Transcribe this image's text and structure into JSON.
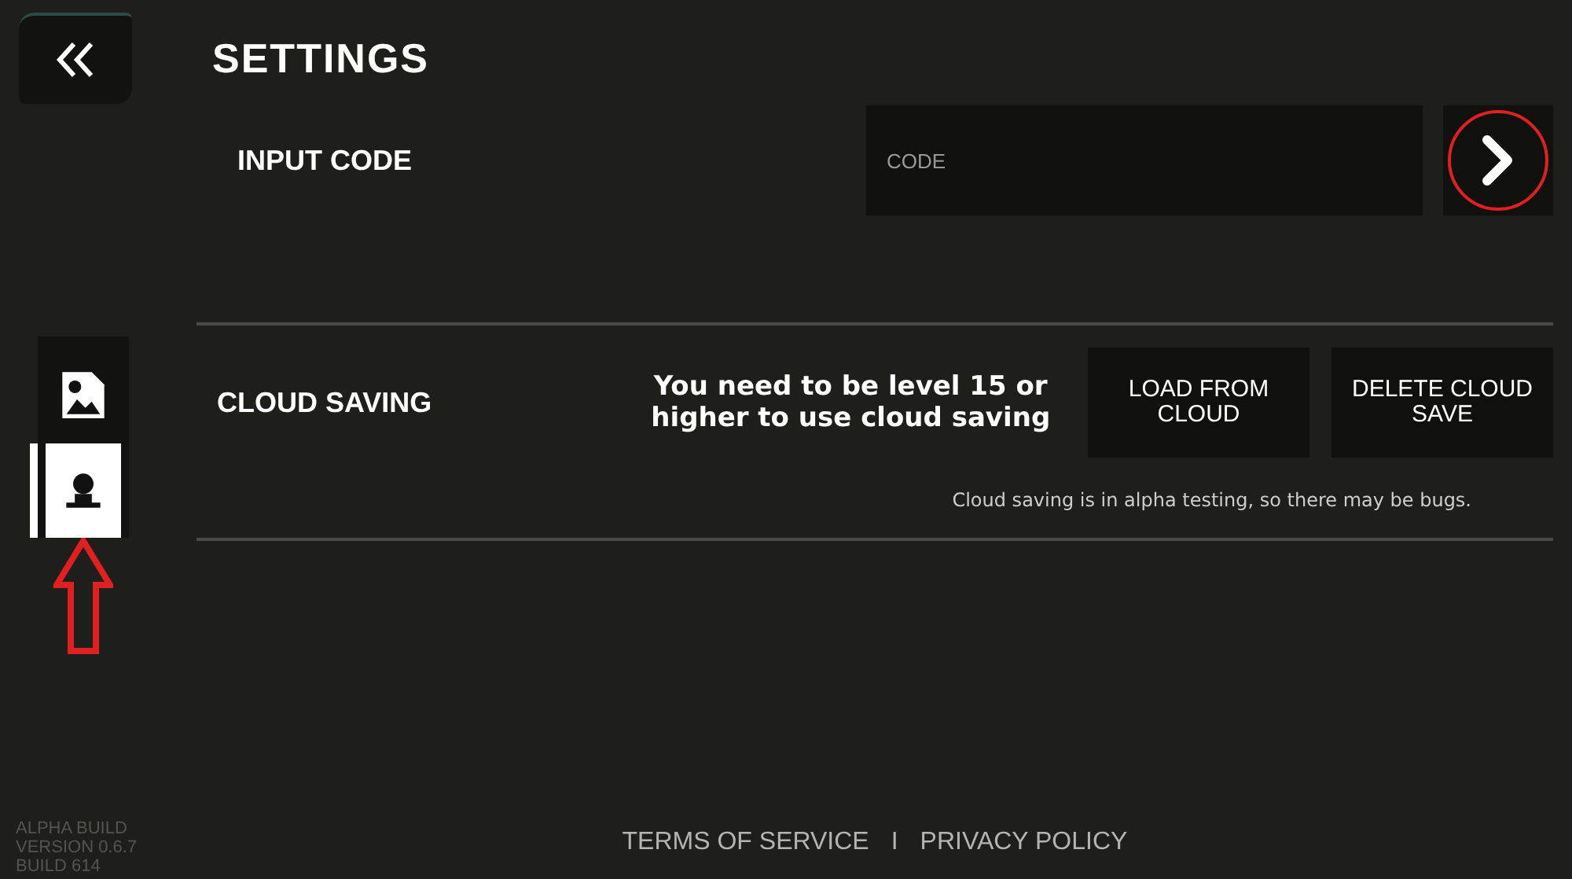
{
  "title": "SETTINGS",
  "sidebar": {
    "tabs": [
      {
        "kind": "image",
        "selected": false
      },
      {
        "kind": "profile",
        "selected": true
      }
    ]
  },
  "code_row": {
    "label": "INPUT CODE",
    "field": {
      "placeholder": "CODE"
    }
  },
  "cloud_row": {
    "label": "CLOUD SAVING",
    "message": "You need to be level 15 or higher to use cloud saving",
    "buttons": [
      "LOAD FROM CLOUD",
      "DELETE CLOUD SAVE"
    ],
    "note": "Cloud saving is in alpha testing, so there may be bugs."
  },
  "footer": {
    "links": [
      "TERMS OF SERVICE",
      "PRIVACY POLICY"
    ],
    "separator": "I"
  },
  "version": [
    "ALPHA BUILD",
    "VERSION 0.6.7",
    "BUILD 614"
  ]
}
